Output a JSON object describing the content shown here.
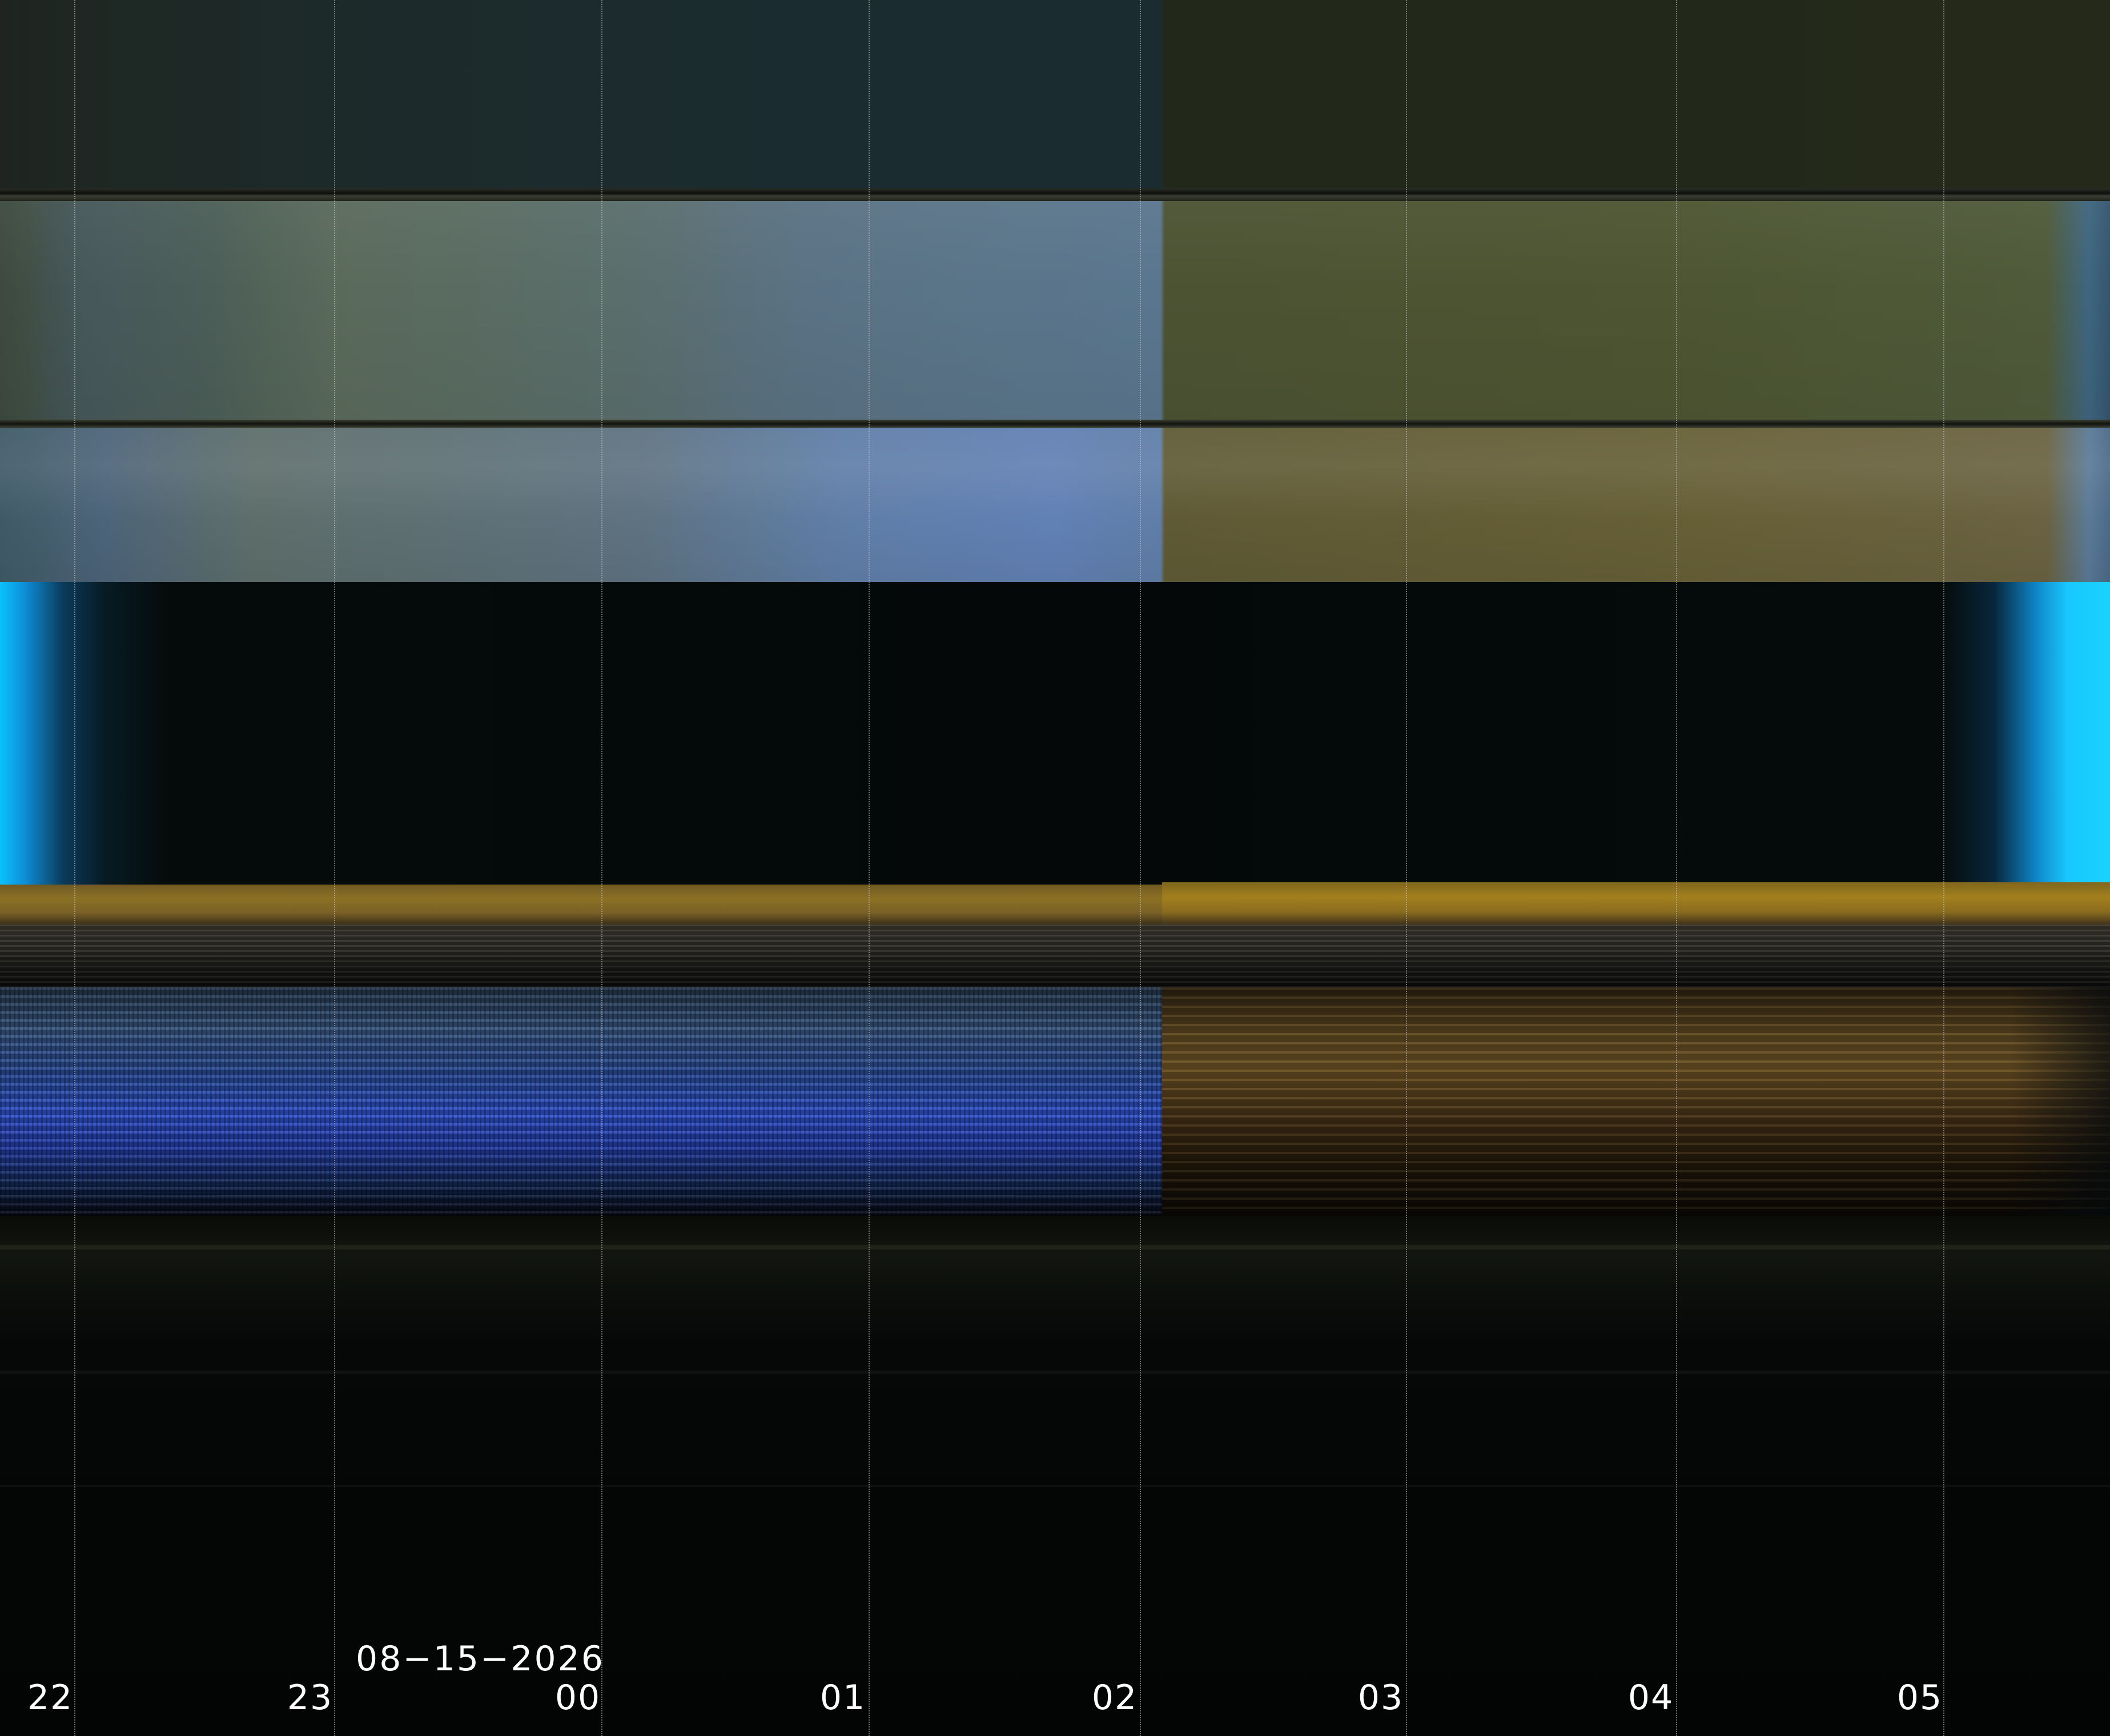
{
  "keogram": {
    "date": "08−15−2026",
    "hour_ticks": [
      "22",
      "23",
      "00",
      "01",
      "02",
      "03",
      "04",
      "05"
    ]
  },
  "colors": {
    "sky_cyan": "#18c8ff",
    "horizon_gold": "#a2801e",
    "ground_blue": "#3156d6",
    "olive": "#4d5532",
    "background": "#030505"
  }
}
